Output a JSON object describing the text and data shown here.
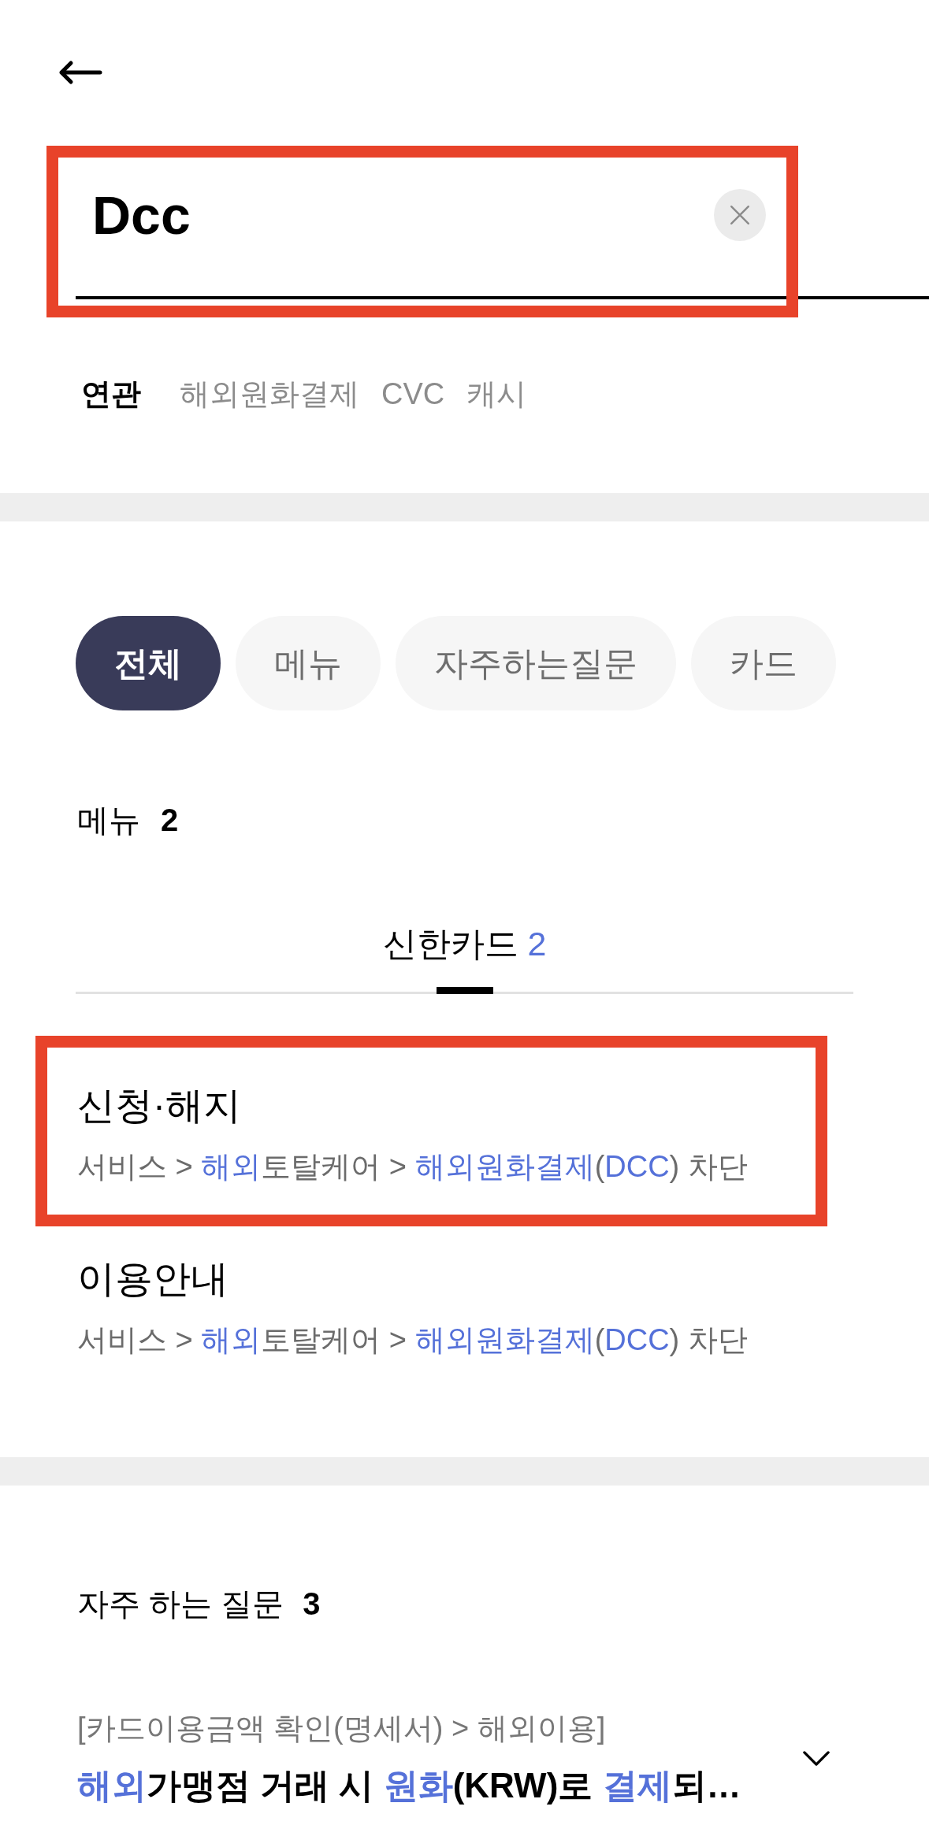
{
  "search": {
    "value": "Dcc",
    "highlighted": true
  },
  "related": {
    "label": "연관",
    "keywords": [
      "해외원화결제",
      "CVC",
      "캐시"
    ]
  },
  "filter_chips": [
    {
      "label": "전체",
      "selected": true
    },
    {
      "label": "메뉴",
      "selected": false
    },
    {
      "label": "자주하는질문",
      "selected": false
    },
    {
      "label": "카드",
      "selected": false
    }
  ],
  "menu_section": {
    "title": "메뉴",
    "count": "2",
    "tabs": [
      {
        "label": "신한카드",
        "count": "2",
        "selected": true
      }
    ],
    "results": [
      {
        "title": "신청·해지",
        "highlighted": true,
        "path": [
          {
            "text": "서비스 > ",
            "match": false
          },
          {
            "text": "해외",
            "match": true
          },
          {
            "text": "토탈케어 > ",
            "match": false
          },
          {
            "text": "해외원화결제",
            "match": true
          },
          {
            "text": "(",
            "match": false
          },
          {
            "text": "DCC",
            "match": true
          },
          {
            "text": ") 차단",
            "match": false
          }
        ]
      },
      {
        "title": "이용안내",
        "highlighted": false,
        "path": [
          {
            "text": "서비스 > ",
            "match": false
          },
          {
            "text": "해외",
            "match": true
          },
          {
            "text": "토탈케어 > ",
            "match": false
          },
          {
            "text": "해외원화결제",
            "match": true
          },
          {
            "text": "(",
            "match": false
          },
          {
            "text": "DCC",
            "match": true
          },
          {
            "text": ") 차단",
            "match": false
          }
        ]
      }
    ]
  },
  "faq_section": {
    "title": "자주 하는 질문",
    "count": "3",
    "items": [
      {
        "category": "[카드이용금액 확인(명세서) > 해외이용]",
        "expanded": false,
        "question": [
          {
            "text": "해외",
            "match": true
          },
          {
            "text": "가맹점 거래 시 ",
            "match": false
          },
          {
            "text": "원화",
            "match": true
          },
          {
            "text": "(KRW)로 ",
            "match": false
          },
          {
            "text": "결제",
            "match": true
          },
          {
            "text": "되…",
            "match": false
          }
        ]
      }
    ]
  }
}
